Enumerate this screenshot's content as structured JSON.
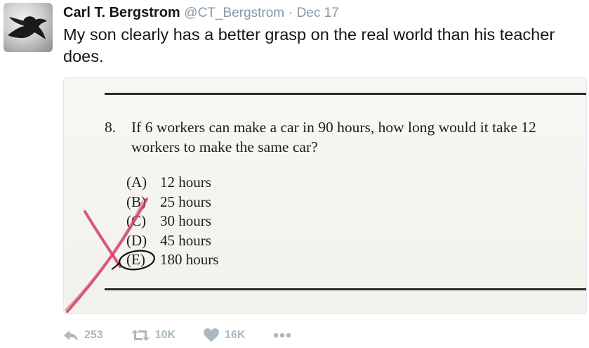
{
  "author": {
    "name": "Carl T. Bergstrom",
    "handle": "@CT_Bergstrom",
    "separator": "·",
    "date": "Dec 17"
  },
  "tweet": {
    "text": "My son clearly has a better grasp on the real world than his teacher does."
  },
  "media": {
    "question_number": "8.",
    "question_text": "If 6 workers can make a car in 90 hours, how long would it take 12 workers to make the same car?",
    "options": [
      {
        "letter": "(A)",
        "text": "12 hours"
      },
      {
        "letter": "(B)",
        "text": "25 hours"
      },
      {
        "letter": "(C)",
        "text": "30 hours"
      },
      {
        "letter": "(D)",
        "text": "45 hours"
      },
      {
        "letter": "(E)",
        "text": "180 hours"
      }
    ]
  },
  "actions": {
    "reply_count": "253",
    "retweet_count": "10K",
    "like_count": "16K",
    "icons": [
      "reply-icon",
      "retweet-icon",
      "like-icon",
      "more-icon"
    ]
  },
  "colors": {
    "name": "#14171a",
    "muted": "#8899a6",
    "action": "#aab8c2",
    "red_pencil": "#d23a5e"
  }
}
